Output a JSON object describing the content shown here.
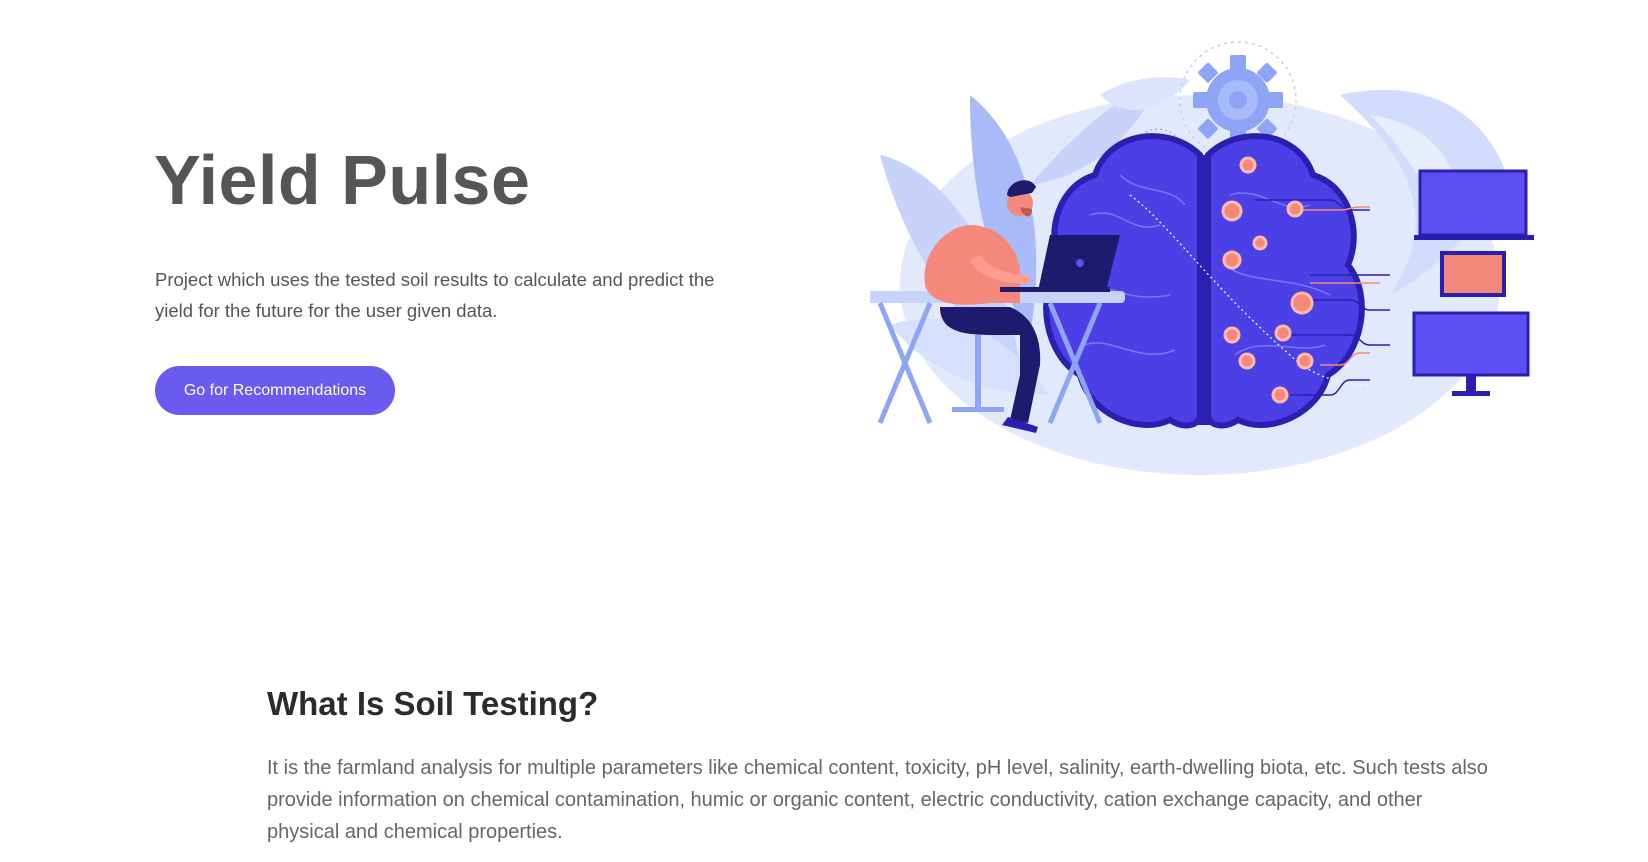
{
  "hero": {
    "title": "Yield Pulse",
    "description": "Project which uses the tested soil results to calculate and predict the yield for the future for the user given data.",
    "cta_label": "Go for Recommendations"
  },
  "illustration": {
    "icon": "brain-ai-illustration"
  },
  "section": {
    "heading": "What Is Soil Testing?",
    "body": "It is the farmland analysis for multiple parameters like chemical content, toxicity, pH level, salinity, earth-dwelling biota, etc. Such tests also provide information on chemical contamination, humic or organic content, electric conductivity, cation exchange capacity, and other physical and chemical properties."
  },
  "colors": {
    "accent": "#6a5af0",
    "brain": "#4b40e6",
    "node": "#f4897b",
    "leaf": "#c9d4fb"
  }
}
